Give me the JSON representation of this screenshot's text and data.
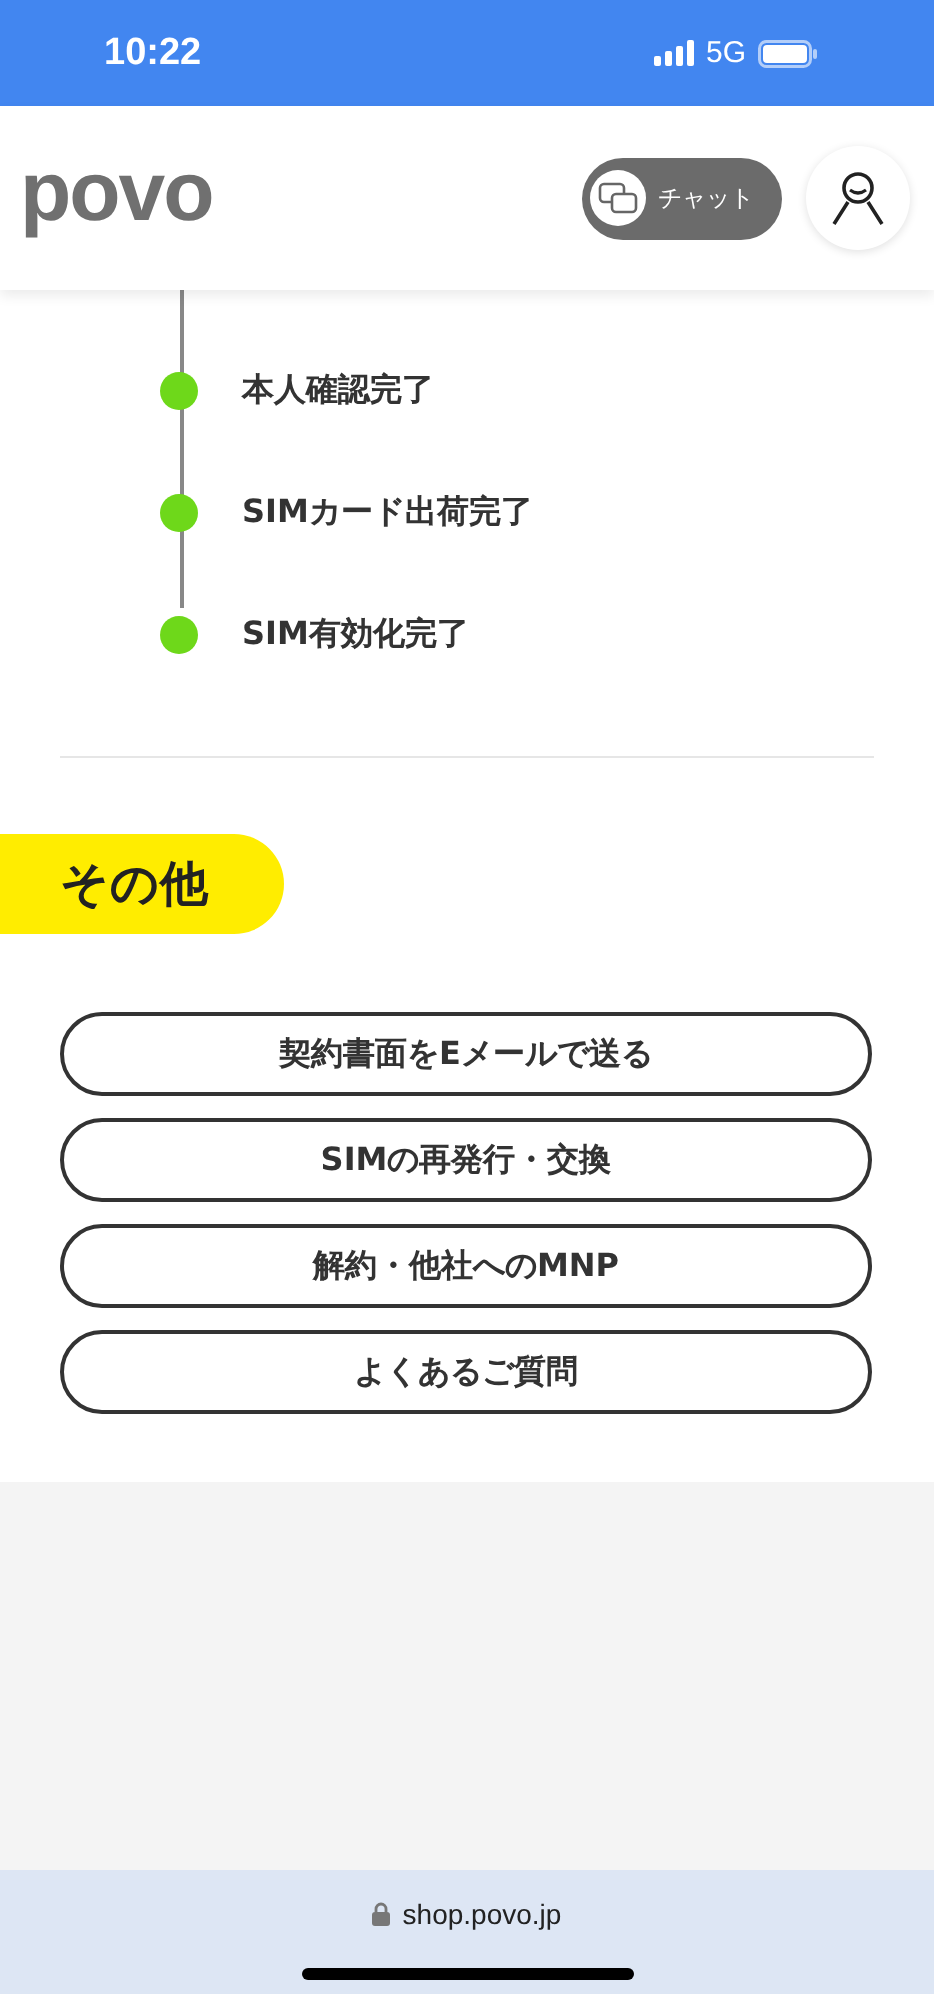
{
  "status_bar": {
    "time": "10:22",
    "network": "5G"
  },
  "header": {
    "logo": "povo",
    "chat_button": "チャット"
  },
  "timeline": [
    {
      "label": "本人確認完了",
      "done": true
    },
    {
      "label": "SIMカード出荷完了",
      "done": true
    },
    {
      "label": "SIM有効化完了",
      "done": true
    }
  ],
  "other": {
    "heading": "その他",
    "buttons": [
      "契約書面をEメールで送る",
      "SIMの再発行・交換",
      "解約・他社へのMNP",
      "よくあるご質問"
    ]
  },
  "address_bar": {
    "url": "shop.povo.jp"
  }
}
